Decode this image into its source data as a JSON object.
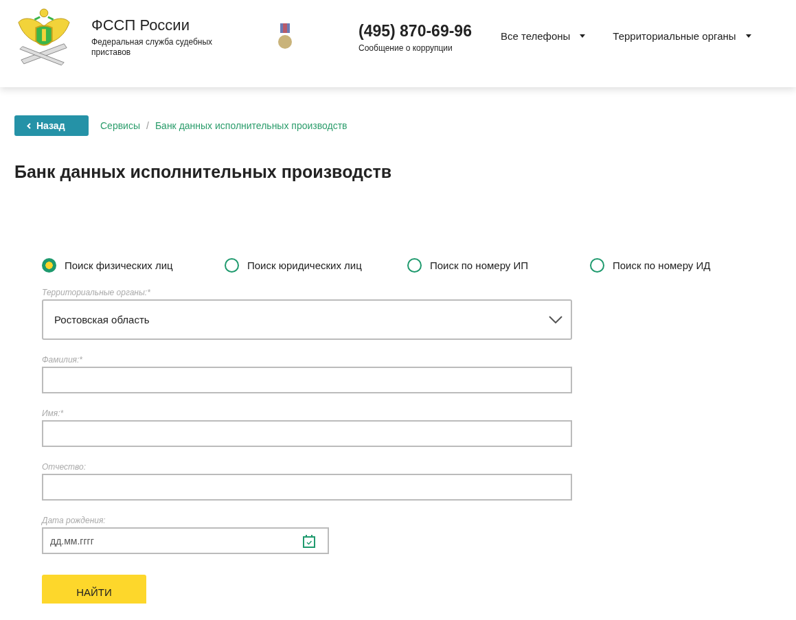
{
  "header": {
    "org_name": "ФССП России",
    "org_subtitle": "Федеральная служба судебных приставов",
    "phone": "(495) 870-69-96",
    "phone_caption": "Сообщение о коррупции",
    "nav": [
      {
        "label": "Все телефоны",
        "expanded": false
      },
      {
        "label": "Территориальные органы",
        "expanded": false
      }
    ]
  },
  "back_button": "Назад",
  "breadcrumbs": [
    "Сервисы",
    "Банк данных исполнительных производств"
  ],
  "breadcrumb_separator": "/",
  "page_title": "Банк данных исполнительных производств",
  "search_types": [
    {
      "label": "Поиск физических лиц",
      "selected": true
    },
    {
      "label": "Поиск юридических лиц",
      "selected": false
    },
    {
      "label": "Поиск по номеру ИП",
      "selected": false
    },
    {
      "label": "Поиск по номеру ИД",
      "selected": false
    }
  ],
  "fields": [
    {
      "kind": "select",
      "label": "Территориальные органы:*",
      "value": "Ростовская область"
    },
    {
      "kind": "text",
      "label": "Фамилия:*"
    },
    {
      "kind": "text",
      "label": "Имя:*"
    },
    {
      "kind": "text",
      "label": "Отчество:"
    },
    {
      "kind": "date",
      "label": "Дата рождения:",
      "placeholder": "дд.мм.гггг"
    }
  ],
  "submit_button": "НАЙТИ"
}
